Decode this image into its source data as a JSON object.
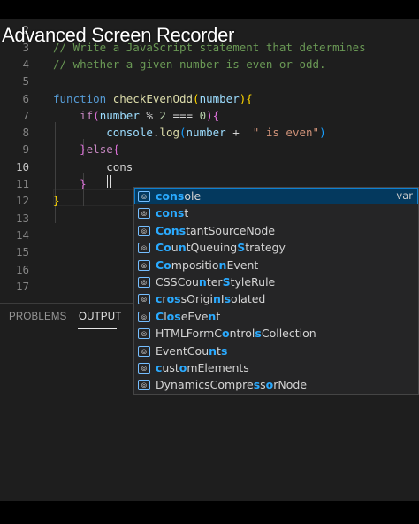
{
  "watermark": "Advanced Screen Recorder",
  "editor": {
    "lines": [
      {
        "num": "1",
        "tokens": []
      },
      {
        "num": "2",
        "tokens": []
      },
      {
        "num": "3",
        "tokens": [
          {
            "t": "// Write a JavaScript statement that determines",
            "c": "c-comment"
          }
        ]
      },
      {
        "num": "4",
        "tokens": [
          {
            "t": "// whether a given number is even or odd.",
            "c": "c-comment"
          }
        ]
      },
      {
        "num": "5",
        "tokens": []
      },
      {
        "num": "6",
        "tokens": [
          {
            "t": "function ",
            "c": "c-kw"
          },
          {
            "t": "checkEvenOdd",
            "c": "c-fn"
          },
          {
            "t": "(",
            "c": "c-brace1"
          },
          {
            "t": "number",
            "c": "c-var"
          },
          {
            "t": ")",
            "c": "c-brace1"
          },
          {
            "t": "{",
            "c": "c-brace1"
          }
        ]
      },
      {
        "num": "7",
        "tokens": [
          {
            "t": "    if",
            "c": "c-ctrl"
          },
          {
            "t": "(",
            "c": "c-brace2"
          },
          {
            "t": "number",
            "c": "c-var"
          },
          {
            "t": " % ",
            "c": "c-op"
          },
          {
            "t": "2",
            "c": "c-num"
          },
          {
            "t": " === ",
            "c": "c-op"
          },
          {
            "t": "0",
            "c": "c-num"
          },
          {
            "t": ")",
            "c": "c-brace2"
          },
          {
            "t": "{",
            "c": "c-brace2"
          }
        ]
      },
      {
        "num": "8",
        "tokens": [
          {
            "t": "        console",
            "c": "c-var"
          },
          {
            "t": ".",
            "c": "c-op"
          },
          {
            "t": "log",
            "c": "c-fn"
          },
          {
            "t": "(",
            "c": "c-brace3"
          },
          {
            "t": "number",
            "c": "c-var"
          },
          {
            "t": " +  ",
            "c": "c-op"
          },
          {
            "t": "\" is even\"",
            "c": "c-str"
          },
          {
            "t": ")",
            "c": "c-brace3"
          }
        ]
      },
      {
        "num": "9",
        "tokens": [
          {
            "t": "    }",
            "c": "c-brace2"
          },
          {
            "t": "else",
            "c": "c-ctrl"
          },
          {
            "t": "{",
            "c": "c-brace2"
          }
        ]
      },
      {
        "num": "10",
        "tokens": [
          {
            "t": "        cons",
            "c": "c-op"
          }
        ],
        "active": true
      },
      {
        "num": "11",
        "tokens": [
          {
            "t": "    }",
            "c": "c-brace2"
          }
        ]
      },
      {
        "num": "12",
        "tokens": [
          {
            "t": "}",
            "c": "c-brace1"
          }
        ]
      },
      {
        "num": "13",
        "tokens": []
      },
      {
        "num": "14",
        "tokens": []
      },
      {
        "num": "15",
        "tokens": []
      },
      {
        "num": "16",
        "tokens": []
      },
      {
        "num": "17",
        "tokens": []
      }
    ]
  },
  "panel": {
    "tabs": [
      {
        "label": "PROBLEMS",
        "active": false
      },
      {
        "label": "OUTPUT",
        "active": true
      }
    ]
  },
  "suggestions": [
    {
      "parts": [
        {
          "t": "cons",
          "h": true
        },
        {
          "t": "ole",
          "h": false
        }
      ],
      "detail": "var",
      "icon": "variable-icon"
    },
    {
      "parts": [
        {
          "t": "cons",
          "h": true
        },
        {
          "t": "t",
          "h": false
        }
      ],
      "detail": "",
      "icon": "variable-icon"
    },
    {
      "parts": [
        {
          "t": "Cons",
          "h": true
        },
        {
          "t": "tantSourceNode",
          "h": false
        }
      ],
      "detail": "",
      "icon": "variable-icon"
    },
    {
      "parts": [
        {
          "t": "Co",
          "h": true
        },
        {
          "t": "u",
          "h": false
        },
        {
          "t": "n",
          "h": true
        },
        {
          "t": "tQueuing",
          "h": false
        },
        {
          "t": "S",
          "h": true
        },
        {
          "t": "trategy",
          "h": false
        }
      ],
      "detail": "",
      "icon": "variable-icon"
    },
    {
      "parts": [
        {
          "t": "Co",
          "h": true
        },
        {
          "t": "mpositio",
          "h": false
        },
        {
          "t": "n",
          "h": true
        },
        {
          "t": "Event",
          "h": false
        }
      ],
      "detail": "",
      "icon": "variable-icon"
    },
    {
      "parts": [
        {
          "t": "CSSCo",
          "h": false
        },
        {
          "t": "u",
          "h": false
        },
        {
          "t": "n",
          "h": true
        },
        {
          "t": "ter",
          "h": false
        },
        {
          "t": "S",
          "h": true
        },
        {
          "t": "tyleRule",
          "h": false
        }
      ],
      "detail": "",
      "icon": "variable-icon"
    },
    {
      "parts": [
        {
          "t": "c",
          "h": true
        },
        {
          "t": "r",
          "h": false
        },
        {
          "t": "o",
          "h": true
        },
        {
          "t": "s",
          "h": true
        },
        {
          "t": "s",
          "h": false
        },
        {
          "t": "O",
          "h": false
        },
        {
          "t": "rigi",
          "h": false
        },
        {
          "t": "n",
          "h": true
        },
        {
          "t": "I",
          "h": false
        },
        {
          "t": "s",
          "h": true
        },
        {
          "t": "olated",
          "h": false
        }
      ],
      "detail": "",
      "icon": "variable-icon"
    },
    {
      "parts": [
        {
          "t": "C",
          "h": true
        },
        {
          "t": "l",
          "h": false
        },
        {
          "t": "o",
          "h": true
        },
        {
          "t": "s",
          "h": true
        },
        {
          "t": "eEve",
          "h": false
        },
        {
          "t": "n",
          "h": true
        },
        {
          "t": "t",
          "h": false
        }
      ],
      "detail": "",
      "icon": "variable-icon"
    },
    {
      "parts": [
        {
          "t": "HTMLFormC",
          "h": false
        },
        {
          "t": "o",
          "h": true
        },
        {
          "t": "ntrol",
          "h": false
        },
        {
          "t": "s",
          "h": true
        },
        {
          "t": "Collection",
          "h": false
        }
      ],
      "detail": "",
      "icon": "variable-icon"
    },
    {
      "parts": [
        {
          "t": "EventCo",
          "h": false
        },
        {
          "t": "u",
          "h": false
        },
        {
          "t": "n",
          "h": true
        },
        {
          "t": "t",
          "h": false
        },
        {
          "t": "s",
          "h": true
        }
      ],
      "detail": "",
      "icon": "variable-icon"
    },
    {
      "parts": [
        {
          "t": "c",
          "h": true
        },
        {
          "t": "ust",
          "h": false
        },
        {
          "t": "o",
          "h": true
        },
        {
          "t": "mElements",
          "h": false
        }
      ],
      "detail": "",
      "icon": "variable-icon"
    },
    {
      "parts": [
        {
          "t": "DynamicsCompre",
          "h": false
        },
        {
          "t": "s",
          "h": true
        },
        {
          "t": "s",
          "h": false
        },
        {
          "t": "o",
          "h": true
        },
        {
          "t": "rNode",
          "h": false
        }
      ],
      "detail": "",
      "icon": "variable-icon"
    }
  ]
}
